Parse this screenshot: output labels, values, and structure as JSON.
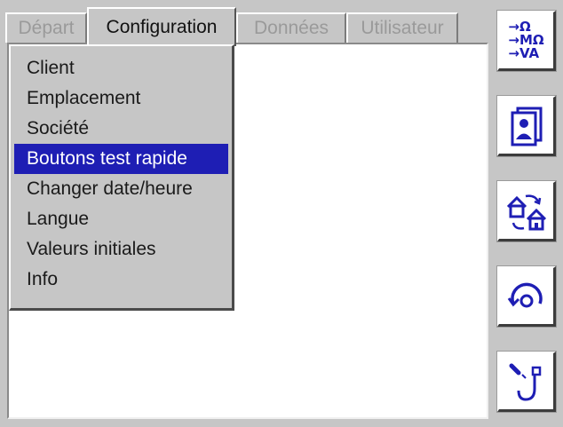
{
  "tabs": [
    {
      "label": "Départ",
      "active": false
    },
    {
      "label": "Configuration",
      "active": true
    },
    {
      "label": "Données",
      "active": false
    },
    {
      "label": "Utilisateur",
      "active": false
    }
  ],
  "menu": {
    "items": [
      {
        "label": "Client"
      },
      {
        "label": "Emplacement"
      },
      {
        "label": "Société"
      },
      {
        "label": "Boutons test rapide",
        "selected": true
      },
      {
        "label": "Changer date/heure"
      },
      {
        "label": "Langue"
      },
      {
        "label": "Valeurs initiales"
      },
      {
        "label": "Info"
      }
    ]
  },
  "toolbar": {
    "units_button": {
      "lines": [
        "→Ω",
        "→MΩ",
        "→VA"
      ],
      "icon": "units-icon"
    },
    "buttons": [
      {
        "icon": "user-profile-icon"
      },
      {
        "icon": "transfer-house-icon"
      },
      {
        "icon": "rotate-cycle-icon"
      },
      {
        "icon": "probe-pen-icon"
      }
    ]
  },
  "colors": {
    "accent": "#1e1eb4",
    "background": "#c6c6c6",
    "panel": "#ffffff"
  }
}
